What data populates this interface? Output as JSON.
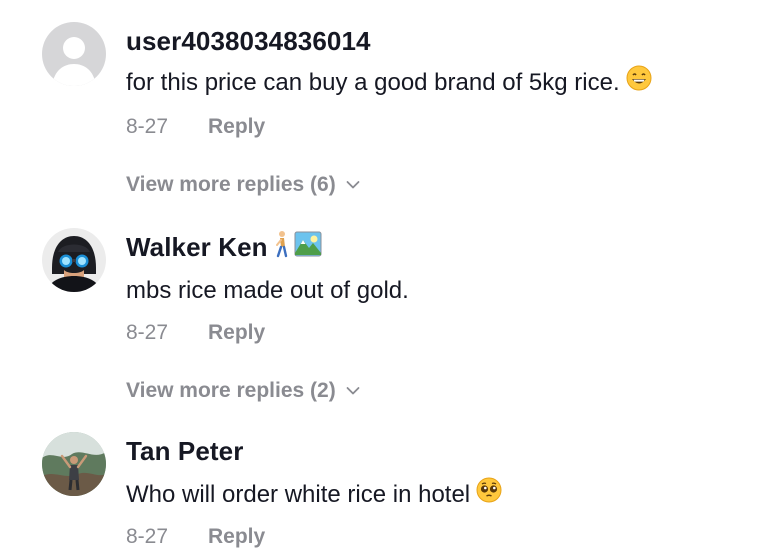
{
  "comments": [
    {
      "username": "user4038034836014",
      "text": "for this price can buy a good brand of 5kg rice.",
      "text_emoji": "grinning-face-emoji",
      "date": "8-27",
      "reply_label": "Reply",
      "more_replies": "View more replies (6)",
      "avatar": "default-avatar"
    },
    {
      "username": "Walker Ken",
      "name_emojis": [
        "person-walking-emoji",
        "sunrise-over-mountains-emoji"
      ],
      "text": "mbs rice made out of gold.",
      "date": "8-27",
      "reply_label": "Reply",
      "more_replies": "View more replies (2)",
      "avatar": "photo-avatar"
    },
    {
      "username": "Tan Peter",
      "text": "Who will order white rice in hotel",
      "text_emoji": "pleading-face-emoji",
      "date": "8-27",
      "reply_label": "Reply",
      "avatar": "photo-avatar"
    }
  ],
  "colors": {
    "username": "#161823",
    "meta": "#8a8b91",
    "avatar_default_bg": "#d6d6d8"
  }
}
